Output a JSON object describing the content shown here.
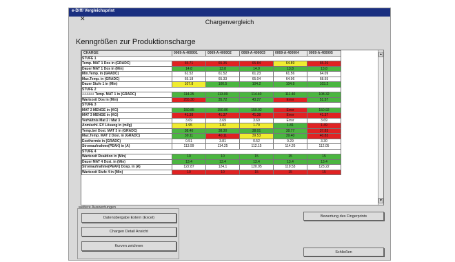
{
  "window": {
    "titlebar_text": "e-Diff/ Vergleichsprint",
    "title": "Chargenvergleich",
    "heading": "Kenngrößen zur Produktionscharge"
  },
  "table": {
    "header_label": "CHARGE",
    "columns": [
      "0069-A-400001",
      "0069-A-400002",
      "0069-A-400003",
      "0069-A-400004",
      "0069-A-400005"
    ],
    "rows": [
      {
        "type": "section",
        "label": "STUFE 1"
      },
      {
        "type": "data",
        "label": "Temp. MAT 1 Dos in (GRADC)",
        "values": [
          "65.71",
          "65.35",
          "65.84",
          "64.89",
          "65.26"
        ],
        "colors": [
          "r",
          "r",
          "r",
          "y",
          "r"
        ]
      },
      {
        "type": "data",
        "label": "Dauer MAT 1 Dos in (Min)",
        "values": [
          "14.8",
          "13.8",
          "14.9",
          "13.8",
          "13.8"
        ],
        "colors": [
          "g",
          "g",
          "g",
          "g",
          "g"
        ]
      },
      {
        "type": "data",
        "label": "Min.Temp. in (GRADC)",
        "values": [
          "61.52",
          "61.52",
          "61.23",
          "61.56",
          "64.09"
        ],
        "colors": [
          "w",
          "w",
          "w",
          "w",
          "w"
        ]
      },
      {
        "type": "data",
        "label": "Max.Temp. in (GRADC)",
        "values": [
          "65.18",
          "65.33",
          "65.04",
          "64.96",
          "68.55"
        ],
        "colors": [
          "w",
          "w",
          "w",
          "w",
          "w"
        ]
      },
      {
        "type": "data",
        "label": "Dauer Stufe 1 in (Min)",
        "values": [
          "107.8",
          "100.5",
          "104.2",
          "104.9",
          "103.2"
        ],
        "colors": [
          "y",
          "g",
          "g",
          "g",
          "g"
        ]
      },
      {
        "type": "section",
        "label": "STUFE 2"
      },
      {
        "type": "data",
        "label": "++++++ Temp. MAT 1 in (GRADC)",
        "values": [
          "114.25",
          "113.09",
          "114.40",
          "111.40",
          "108.32"
        ],
        "colors": [
          "g",
          "g",
          "g",
          "g",
          "g"
        ]
      },
      {
        "type": "data",
        "label": "Wartezeit Dos in (Min)",
        "values": [
          "255.30",
          "35.72",
          "43.27",
          "Error",
          "51.57"
        ],
        "colors": [
          "r",
          "g",
          "g",
          "r",
          "g"
        ]
      },
      {
        "type": "section",
        "label": "STUFE 3"
      },
      {
        "type": "data",
        "label": "MAT 2 MENGE in (KG)",
        "values": [
          "150.85",
          "150.86",
          "150.92",
          "Error",
          "150.92"
        ],
        "colors": [
          "g",
          "g",
          "g",
          "r",
          "g"
        ]
      },
      {
        "type": "data",
        "label": "MAT 3 MENGE in (KG)",
        "values": [
          "41.38",
          "41.37",
          "41.38",
          "Error",
          "41.37"
        ],
        "colors": [
          "r",
          "r",
          "r",
          "r",
          "r"
        ]
      },
      {
        "type": "data",
        "label": "Verhältnis Mat 2 / Mat 3",
        "values": [
          "3.69",
          "3.69",
          "3.69",
          "Error",
          "3.69"
        ],
        "colors": [
          "w",
          "w",
          "w",
          "w",
          "w"
        ]
      },
      {
        "type": "data",
        "label": "Anmischl. EV Lösung in (ml/g)",
        "values": [
          "1.95",
          "1.82",
          "1.79",
          "1.81",
          "1.49"
        ],
        "colors": [
          "y",
          "y",
          "y",
          "g",
          "r"
        ]
      },
      {
        "type": "data",
        "label": "Temp.bei Dosi. MAT 3 in (GRADC)",
        "values": [
          "38.40",
          "38.30",
          "38.01",
          "38.77",
          "37.83"
        ],
        "colors": [
          "g",
          "g",
          "g",
          "g",
          "r"
        ]
      },
      {
        "type": "data",
        "label": "Max.Temp. MAT 2 Dosi. in (GRADC)",
        "values": [
          "39.11",
          "40.11",
          "39.53",
          "39.40",
          "40.83"
        ],
        "colors": [
          "g",
          "r",
          "y",
          "g",
          "r"
        ]
      },
      {
        "type": "data",
        "label": "Exothermie in (GRADC)",
        "values": [
          "0.51",
          "3.81",
          "0.52",
          "0.29",
          "3.30"
        ],
        "colors": [
          "w",
          "w",
          "w",
          "w",
          "w"
        ]
      },
      {
        "type": "data",
        "label": "Stromaufnahme(PEAK) in (A)",
        "values": [
          "113.99",
          "114.25",
          "112.15",
          "114.26",
          "112.05"
        ],
        "colors": [
          "w",
          "w",
          "w",
          "w",
          "w"
        ]
      },
      {
        "type": "section",
        "label": "STUFE 4"
      },
      {
        "type": "data",
        "label": "Wartezeit Reaktion in (Min)",
        "values": [
          "10",
          "10",
          "15",
          "15",
          "15"
        ],
        "colors": [
          "g",
          "g",
          "g",
          "g",
          "g"
        ]
      },
      {
        "type": "data",
        "label": "Dauer MAT 4 Dosi. in (Min)",
        "values": [
          "13.4",
          "13.4",
          "13.4",
          "13.4",
          "13.4"
        ],
        "colors": [
          "g",
          "g",
          "g",
          "g",
          "g"
        ]
      },
      {
        "type": "data",
        "label": "Stromaufnahme(PEAK) Dosp. in (A)",
        "values": [
          "122.87",
          "124.1",
          "120.95",
          "119.53",
          "123.22"
        ],
        "colors": [
          "w",
          "w",
          "w",
          "w",
          "w"
        ]
      },
      {
        "type": "data",
        "label": "Wartezeit Stufe 4 in (Min)",
        "values": [
          "10",
          "10",
          "15",
          "15",
          "15"
        ],
        "colors": [
          "r",
          "r",
          "r",
          "r",
          "r"
        ]
      }
    ]
  },
  "scroll": {
    "up": "▲",
    "down": "▼"
  },
  "panel": {
    "group_label": "weitere Auswertungen",
    "btn_export": "Datenübergabe Extern (Excel)",
    "btn_detail": "Chargen Detail Ansicht",
    "btn_curves": "Kurven zeichnen",
    "btn_rating": "Bewertung des Fingerprints",
    "btn_close": "Schließen"
  },
  "colors": {
    "green": "#4bb640",
    "red": "#e02222",
    "yellow": "#f0ec30",
    "titlebar": "#1a2f80"
  }
}
